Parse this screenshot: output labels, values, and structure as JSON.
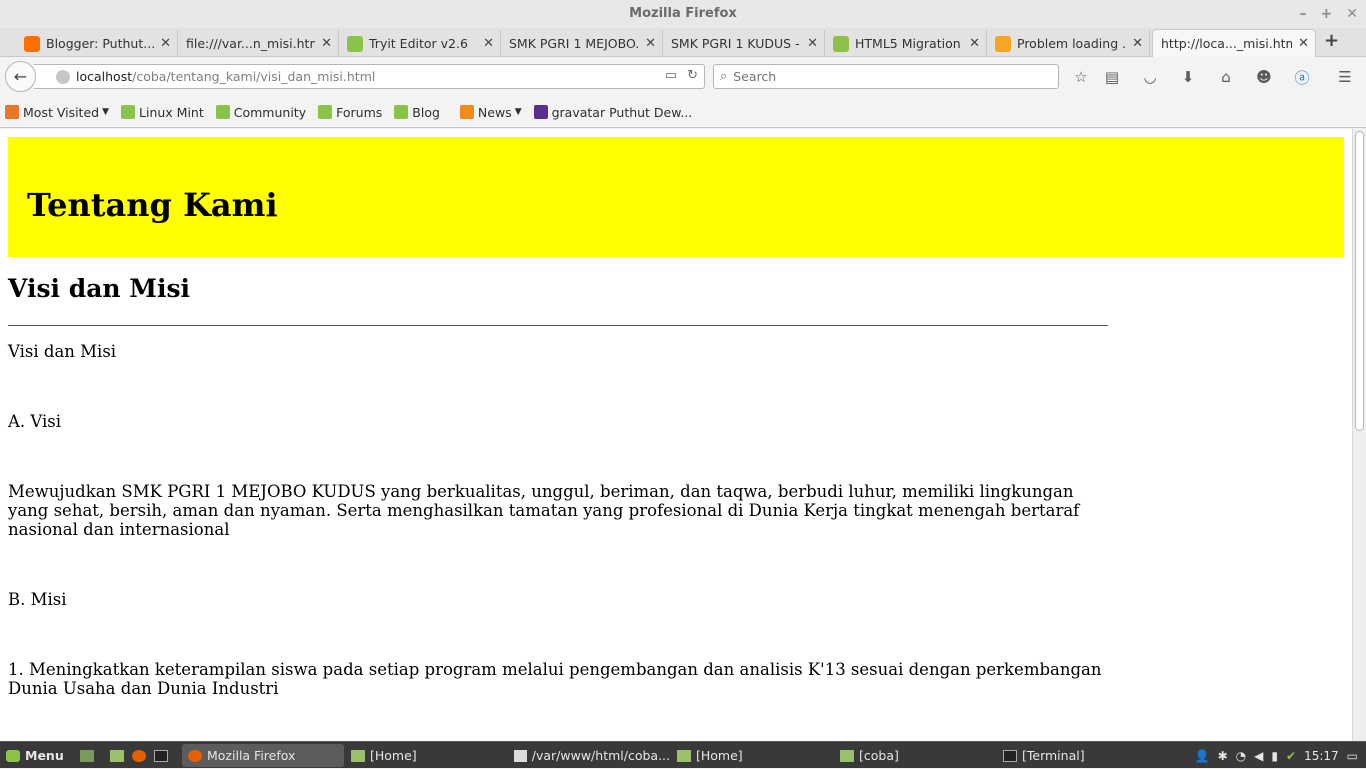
{
  "window": {
    "title": "Mozilla Firefox"
  },
  "tabs": [
    {
      "label": "Blogger: Puthut...",
      "icon": "blogger-icon",
      "color": "#ff6f00"
    },
    {
      "label": "file:///var...n_misi.html",
      "icon": "none",
      "color": ""
    },
    {
      "label": "Tryit Editor v2.6",
      "icon": "w3schools-icon",
      "color": "#8bc34a"
    },
    {
      "label": "SMK PGRI 1 MEJOBO...",
      "icon": "none",
      "color": ""
    },
    {
      "label": "SMK PGRI 1 KUDUS -...",
      "icon": "none",
      "color": ""
    },
    {
      "label": "HTML5 Migration",
      "icon": "w3schools-icon",
      "color": "#8bc34a"
    },
    {
      "label": "Problem loading ...",
      "icon": "warning-icon",
      "color": "#f5a623"
    },
    {
      "label": "http://loca..._misi.html",
      "icon": "none",
      "color": ""
    }
  ],
  "navbar": {
    "url_host": "localhost",
    "url_path": "/coba/tentang_kami/visi_dan_misi.html",
    "search_placeholder": "Search"
  },
  "bookmarks": [
    {
      "label": "Most Visited",
      "icon": "most-visited-icon",
      "dropdown": true
    },
    {
      "label": "Linux Mint",
      "icon": "mint-icon"
    },
    {
      "label": "Community",
      "icon": "mint-icon"
    },
    {
      "label": "Forums",
      "icon": "mint-icon"
    },
    {
      "label": "Blog",
      "icon": "mint-icon"
    },
    {
      "label": "News",
      "icon": "rss-icon",
      "dropdown": true
    },
    {
      "label": "gravatar Puthut Dew...",
      "icon": "gravatar-icon"
    }
  ],
  "page": {
    "banner_title": "Tentang Kami",
    "banner_color": "#ffff00",
    "heading": "Visi dan Misi",
    "paragraphs": [
      "Visi dan Misi",
      "A. Visi",
      "Mewujudkan SMK PGRI 1 MEJOBO KUDUS yang berkualitas, unggul, beriman, dan taqwa, berbudi luhur, memiliki lingkungan yang sehat, bersih, aman dan nyaman. Serta menghasilkan tamatan yang profesional di Dunia Kerja tingkat menengah bertaraf nasional dan internasional",
      "B. Misi",
      "1. Meningkatkan keterampilan siswa pada setiap program melalui pengembangan dan analisis K'13 sesuai dengan perkembangan Dunia Usaha dan Dunia Industri"
    ]
  },
  "taskbar": {
    "menu_label": "Menu",
    "items": [
      {
        "label": "Mozilla Firefox",
        "active": true
      },
      {
        "label": "[Home]",
        "active": false
      },
      {
        "label": "/var/www/html/coba...",
        "active": false
      },
      {
        "label": "[Home]",
        "active": false
      },
      {
        "label": "[coba]",
        "active": false
      },
      {
        "label": "[Terminal]",
        "active": false
      }
    ],
    "clock": "15:17"
  }
}
